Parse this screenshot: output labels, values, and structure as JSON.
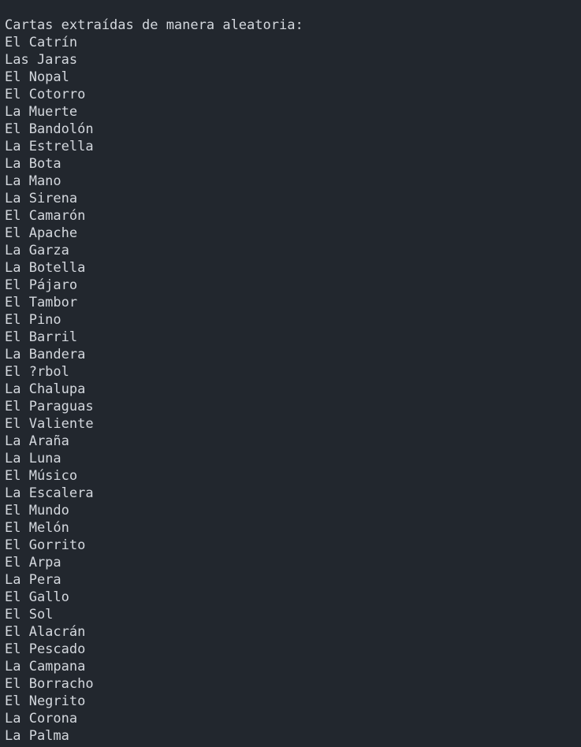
{
  "terminal": {
    "header": "Cartas extraídas de manera aleatoria:",
    "lines": [
      "El Catrín",
      "Las Jaras",
      "El Nopal",
      "El Cotorro",
      "La Muerte",
      "El Bandolón",
      "La Estrella",
      "La Bota",
      "La Mano",
      "La Sirena",
      "El Camarón",
      "El Apache",
      "La Garza",
      "La Botella",
      "El Pájaro",
      "El Tambor",
      "El Pino",
      "El Barril",
      "La Bandera",
      "El ?rbol",
      "La Chalupa",
      "El Paraguas",
      "El Valiente",
      "La Araña",
      "La Luna",
      "El Músico",
      "La Escalera",
      "El Mundo",
      "El Melón",
      "El Gorrito",
      "El Arpa",
      "La Pera",
      "El Gallo",
      "El Sol",
      "El Alacrán",
      "El Pescado",
      "La Campana",
      "El Borracho",
      "El Negrito",
      "La Corona",
      "La Palma"
    ]
  }
}
